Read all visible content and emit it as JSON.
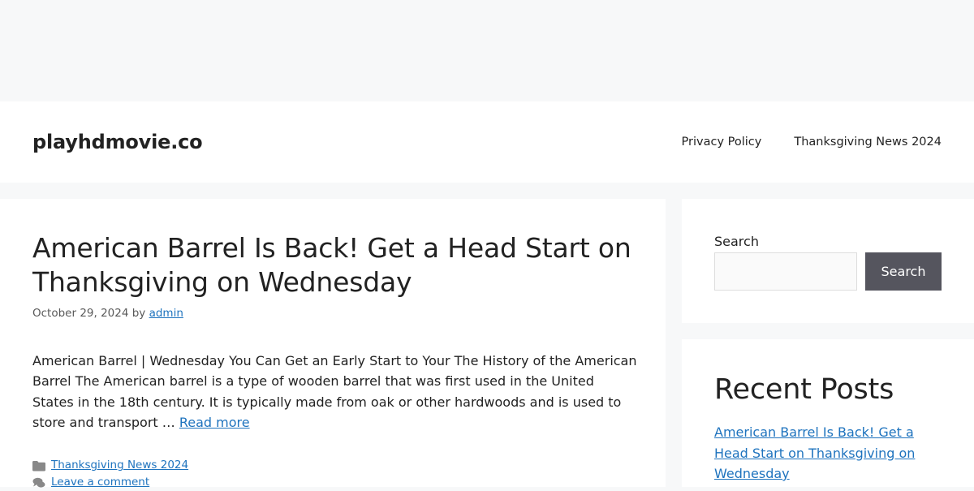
{
  "site": {
    "title": "playhdmovie.co"
  },
  "nav": {
    "items": [
      {
        "label": "Privacy Policy"
      },
      {
        "label": "Thanksgiving News 2024"
      }
    ]
  },
  "article": {
    "title": "American Barrel Is Back! Get a Head Start on Thanksgiving on Wednesday",
    "date": "October 29, 2024",
    "by": " by ",
    "author": "admin",
    "summary": "American Barrel | Wednesday You Can Get an Early Start to Your The History of the American Barrel The American barrel is a type of wooden barrel that was first used in the United States in the 18th century. It is typically made from oak or other hardwoods and is used to store and transport … ",
    "read_more": "Read more",
    "category": "Thanksgiving News 2024",
    "comment_link": "Leave a comment"
  },
  "search_widget": {
    "label": "Search",
    "input_value": "",
    "button_label": "Search"
  },
  "recent_posts": {
    "title": "Recent Posts",
    "items": [
      {
        "label": "American Barrel Is Back! Get a Head Start on Thanksgiving on Wednesday"
      }
    ]
  },
  "colors": {
    "link": "#1e73be",
    "page_bg": "#f7f8f9",
    "button_bg": "#55555e",
    "text": "#222222"
  }
}
